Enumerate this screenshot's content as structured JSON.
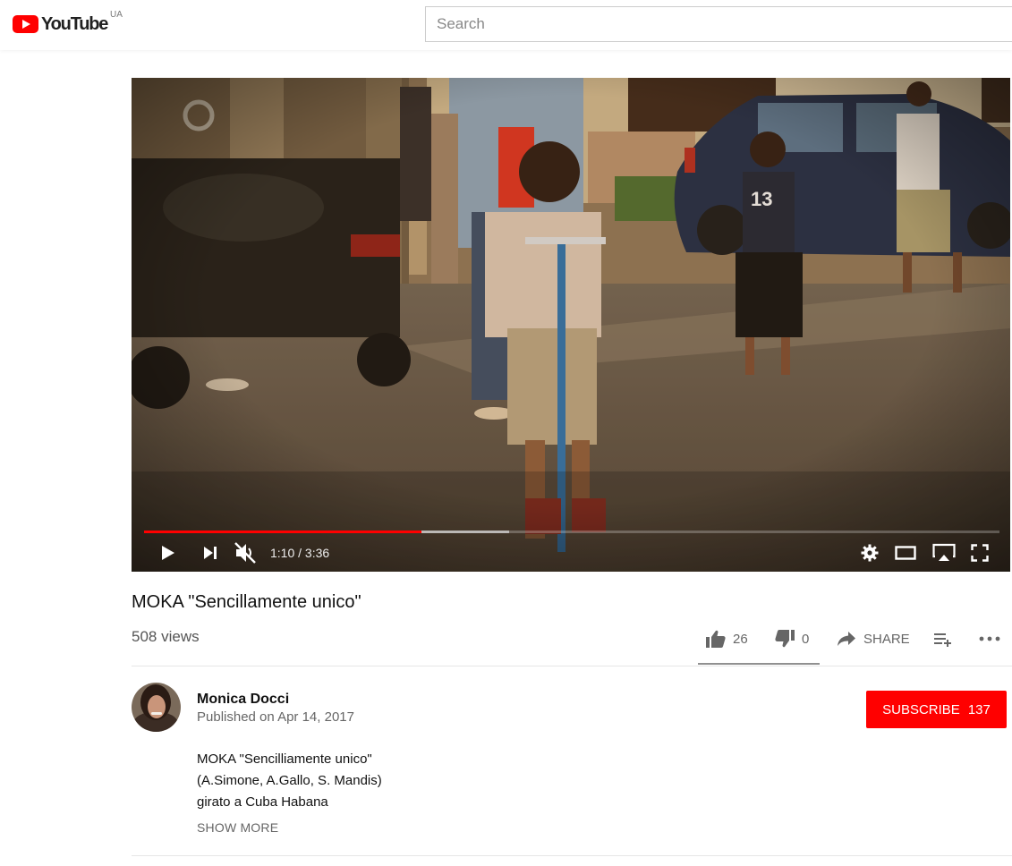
{
  "masthead": {
    "logo_text": "YouTube",
    "region": "UA",
    "search_placeholder": "Search"
  },
  "player": {
    "current_time": "1:10",
    "duration": "3:36",
    "time_display": "1:10 / 3:36",
    "progress_played": 0.324,
    "progress_buffered": 0.427,
    "jersey_number": "13"
  },
  "video": {
    "title": "MOKA \"Sencillamente unico\"",
    "views": "508 views",
    "likes": "26",
    "dislikes": "0",
    "share_label": "SHARE"
  },
  "owner": {
    "channel_name": "Monica Docci",
    "published": "Published on Apr 14, 2017",
    "subscribe_label": "SUBSCRIBE",
    "subscriber_count": "137"
  },
  "description": {
    "lines": [
      "MOKA \"Sencilliamente unico\"",
      "(A.Simone, A.Gallo, S. Mandis)",
      "girato a Cuba Habana"
    ],
    "show_more_label": "SHOW MORE"
  },
  "colors": {
    "brand_red": "#ff0000",
    "progress_buffer": "#dcdcdc"
  }
}
